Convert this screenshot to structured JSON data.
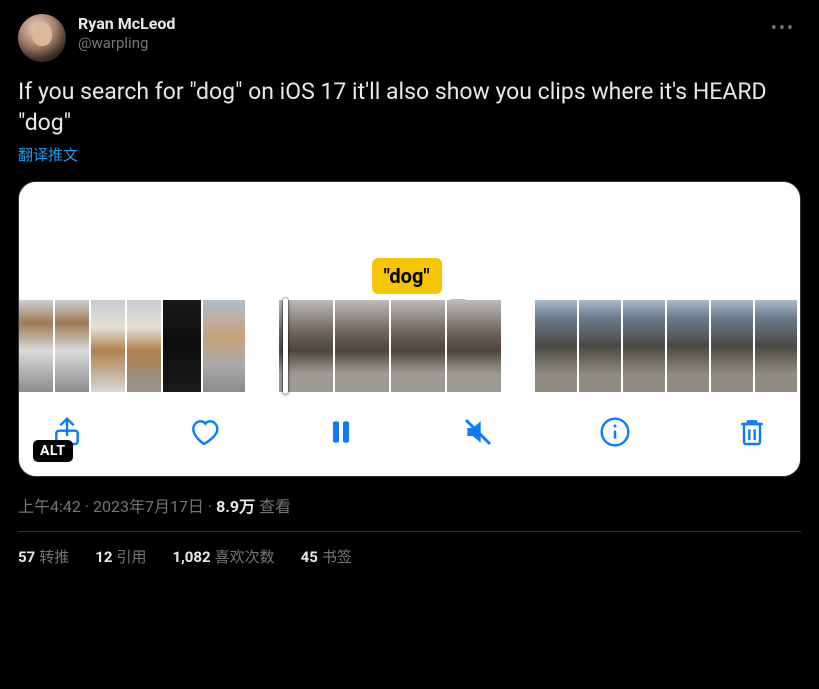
{
  "user": {
    "display_name": "Ryan McLeod",
    "handle": "@warpling"
  },
  "tweet": {
    "text": "If you search for \"dog\" on iOS 17 it'll also show you clips where it's HEARD \"dog\"",
    "translate_label": "翻译推文"
  },
  "media": {
    "tooltip_label": "\"dog\"",
    "alt_badge": "ALT",
    "controls": {
      "share": "share",
      "like": "like",
      "pause": "pause",
      "mute": "muted",
      "info": "info",
      "trash": "trash"
    }
  },
  "meta": {
    "time": "上午4:42",
    "dot1": " · ",
    "date": "2023年7月17日",
    "dot2": " · ",
    "views_num": "8.9万",
    "views_label": " 查看"
  },
  "stats": {
    "retweets_num": "57",
    "retweets_label": "转推",
    "quotes_num": "12",
    "quotes_label": "引用",
    "likes_num": "1,082",
    "likes_label": "喜欢次数",
    "bookmarks_num": "45",
    "bookmarks_label": "书签"
  }
}
